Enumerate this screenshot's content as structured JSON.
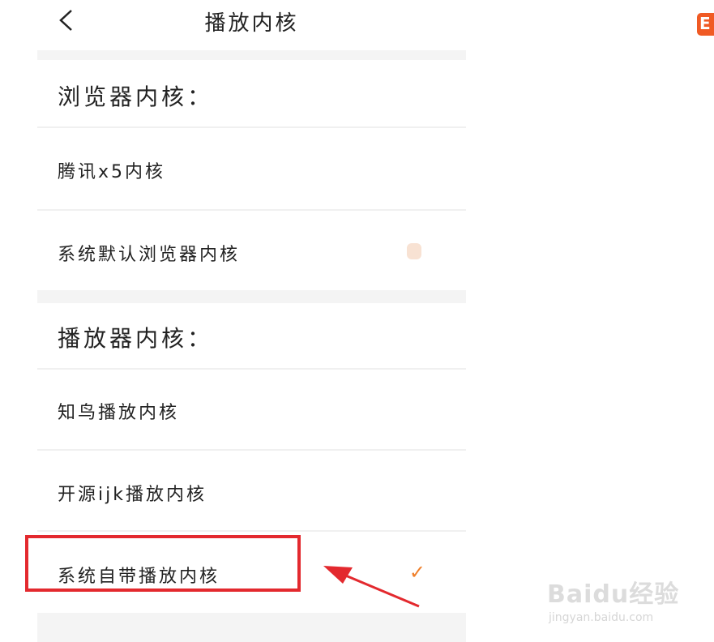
{
  "nav": {
    "title": "播放内核",
    "back_icon": "chevron-left-icon"
  },
  "browser_section": {
    "header": "浏览器内核：",
    "options": [
      {
        "label": "腾讯x5内核",
        "selected": false
      },
      {
        "label": "系统默认浏览器内核",
        "selected": false
      }
    ]
  },
  "player_section": {
    "header": "播放器内核：",
    "options": [
      {
        "label": "知鸟播放内核",
        "selected": false
      },
      {
        "label": "开源ijk播放内核",
        "selected": false
      },
      {
        "label": "系统自带播放内核",
        "selected": true,
        "check_mark": "✓"
      }
    ]
  },
  "annotation": {
    "highlight_color": "#e3292e",
    "arrow_color": "#e3292e"
  },
  "accent_color": "#ef7f2a",
  "watermark": {
    "main": "Baidu经验",
    "sub": "jingyan.baidu.com"
  },
  "corner_logo": {
    "glyph": "E",
    "icon": "app-logo-icon"
  }
}
